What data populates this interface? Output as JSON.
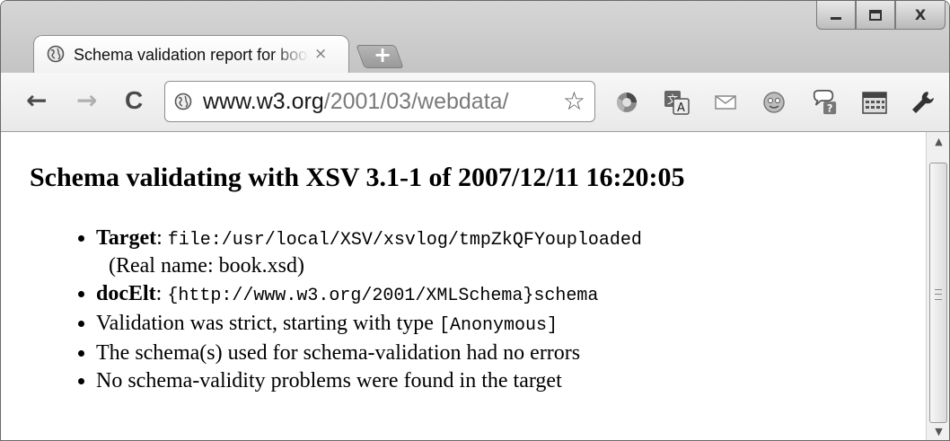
{
  "tab": {
    "title": "Schema validation report for book.xsd",
    "close_glyph": "×",
    "new_tab_glyph": "+"
  },
  "window": {
    "minimize_glyph": "—",
    "maximize_glyph": "▢",
    "close_glyph": "X"
  },
  "toolbar": {
    "back_glyph": "←",
    "forward_glyph": "→",
    "reload_glyph": "C",
    "url_host": "www.w3.org",
    "url_path": "/2001/03/webdata/",
    "star_glyph": "☆",
    "extension_icons": [
      "chrome-toolbar-icon",
      "translate-icon",
      "mail-icon",
      "smiley-icon",
      "chat-help-icon",
      "calendar-icon",
      "wrench-icon"
    ]
  },
  "content": {
    "heading": "Schema validating with XSV 3.1-1 of 2007/12/11 16:20:05",
    "items": [
      {
        "label": "Target",
        "sep": ": ",
        "code": "file:/usr/local/XSV/xsvlog/tmpZkQFYouploaded",
        "note": "(Real name: book.xsd)"
      },
      {
        "label": "docElt",
        "sep": ": ",
        "code": "{http://www.w3.org/2001/XMLSchema}schema"
      },
      {
        "text": "Validation was strict, starting with type ",
        "code": "[Anonymous]"
      },
      {
        "text": "The schema(s) used for schema-validation had no errors"
      },
      {
        "text": "No schema-validity problems were found in the target"
      }
    ]
  },
  "colors": {
    "tabstrip": "#c8c8c8",
    "toolbar": "#efefef",
    "text": "#000000",
    "url_dim": "#7a7a7a"
  }
}
